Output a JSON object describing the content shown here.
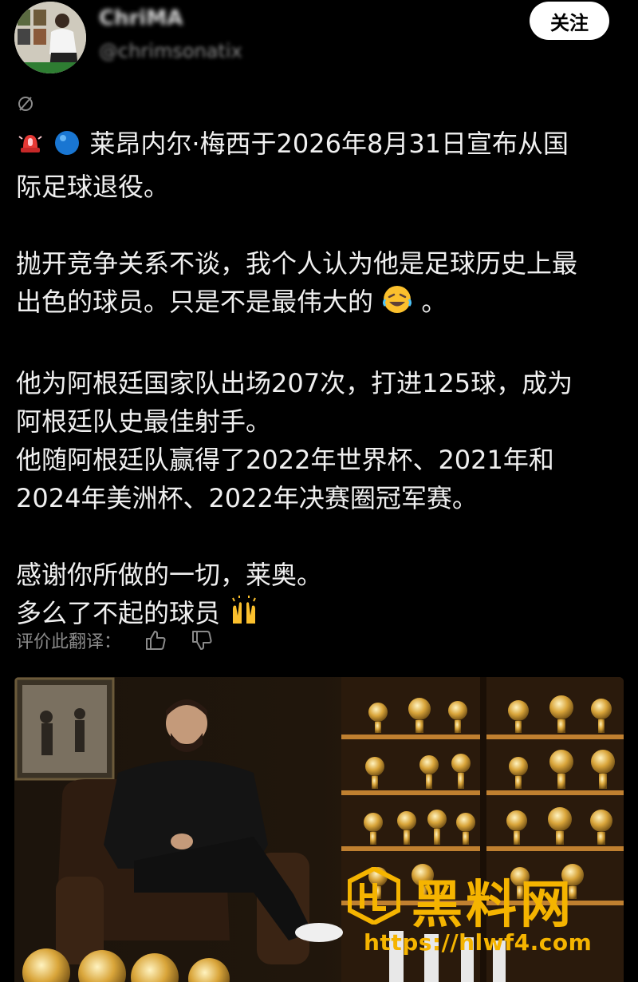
{
  "header": {
    "username": "ChriMA",
    "handle": "@chrimsonatix",
    "follow_label": "关注"
  },
  "translation": {
    "icon": "translate-icon",
    "line1": "莱昂内尔·梅西于2026年8月31日宣布从国",
    "line2": "际足球退役。",
    "line3": "抛开竞争关系不谈，我个人认为他是足球历史上最",
    "line4a": "出色的球员。只是不是最伟大的",
    "line4b": "。",
    "line5": "他为阿根廷国家队出场207次，打进125球，成为",
    "line6": "阿根廷队史最佳射手。",
    "line7": "他随阿根廷队赢得了2022年世界杯、2021年和",
    "line8": "2024年美洲杯、2022年决赛圈冠军赛。",
    "line9": "感谢你所做的一切，莱奥。",
    "line10": "多么了不起的球员"
  },
  "rate": {
    "label": "评价此翻译：",
    "icons": [
      "thumbs-up-icon",
      "thumbs-down-icon"
    ]
  },
  "watermark": {
    "brand": "黑料网",
    "url": "https://hlwf4.com",
    "color": "#f5b400"
  }
}
